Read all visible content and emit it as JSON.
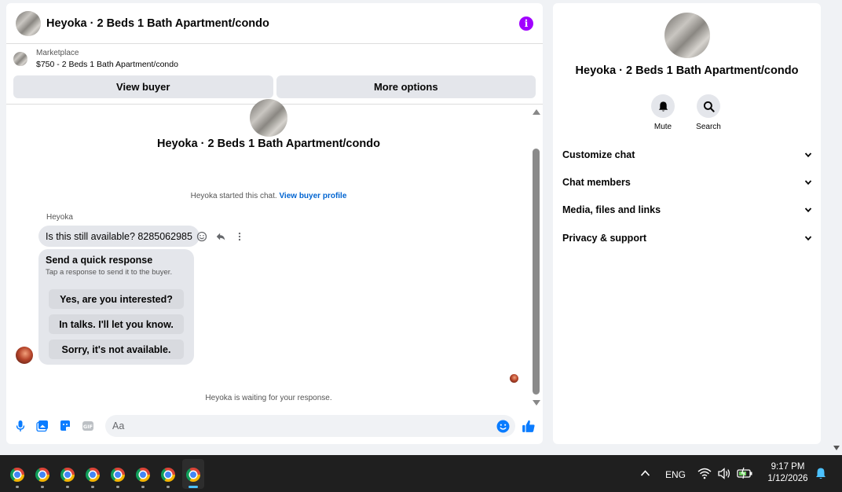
{
  "header": {
    "title": "Heyoka · 2 Beds 1 Bath Apartment/condo",
    "info_icon": "info-icon",
    "info_glyph": "i"
  },
  "listing": {
    "category": "Marketplace",
    "price_title": "$750 - 2 Beds 1 Bath Apartment/condo"
  },
  "actions": {
    "view_buyer": "View buyer",
    "more_options": "More options"
  },
  "thread": {
    "title": "Heyoka · 2 Beds 1 Bath Apartment/condo",
    "started_text": "Heyoka started this chat.",
    "started_link": "View buyer profile",
    "sender": "Heyoka",
    "message": "Is this still available? 8285062985",
    "quick_title": "Send a quick response",
    "quick_sub": "Tap a response to send it to the buyer.",
    "quick_options": [
      "Yes, are you interested?",
      "In talks. I'll let you know.",
      "Sorry, it's not available."
    ],
    "waiting": "Heyoka is waiting for your response."
  },
  "composer": {
    "placeholder": "Aa",
    "icons": [
      "microphone-icon",
      "photo-icon",
      "sticker-icon",
      "gif-icon",
      "emoji-icon",
      "thumbs-up-icon"
    ]
  },
  "side": {
    "title": "Heyoka · 2 Beds 1 Bath Apartment/condo",
    "mute": "Mute",
    "search": "Search",
    "menu": [
      "Customize chat",
      "Chat members",
      "Media, files and links",
      "Privacy & support"
    ]
  },
  "taskbar": {
    "language": "ENG",
    "time": "9:17 PM",
    "date": "1/12/2026"
  },
  "colors": {
    "accent_blue": "#0a7cff",
    "info_purple": "#a100ff",
    "link_blue": "#0064d1"
  }
}
